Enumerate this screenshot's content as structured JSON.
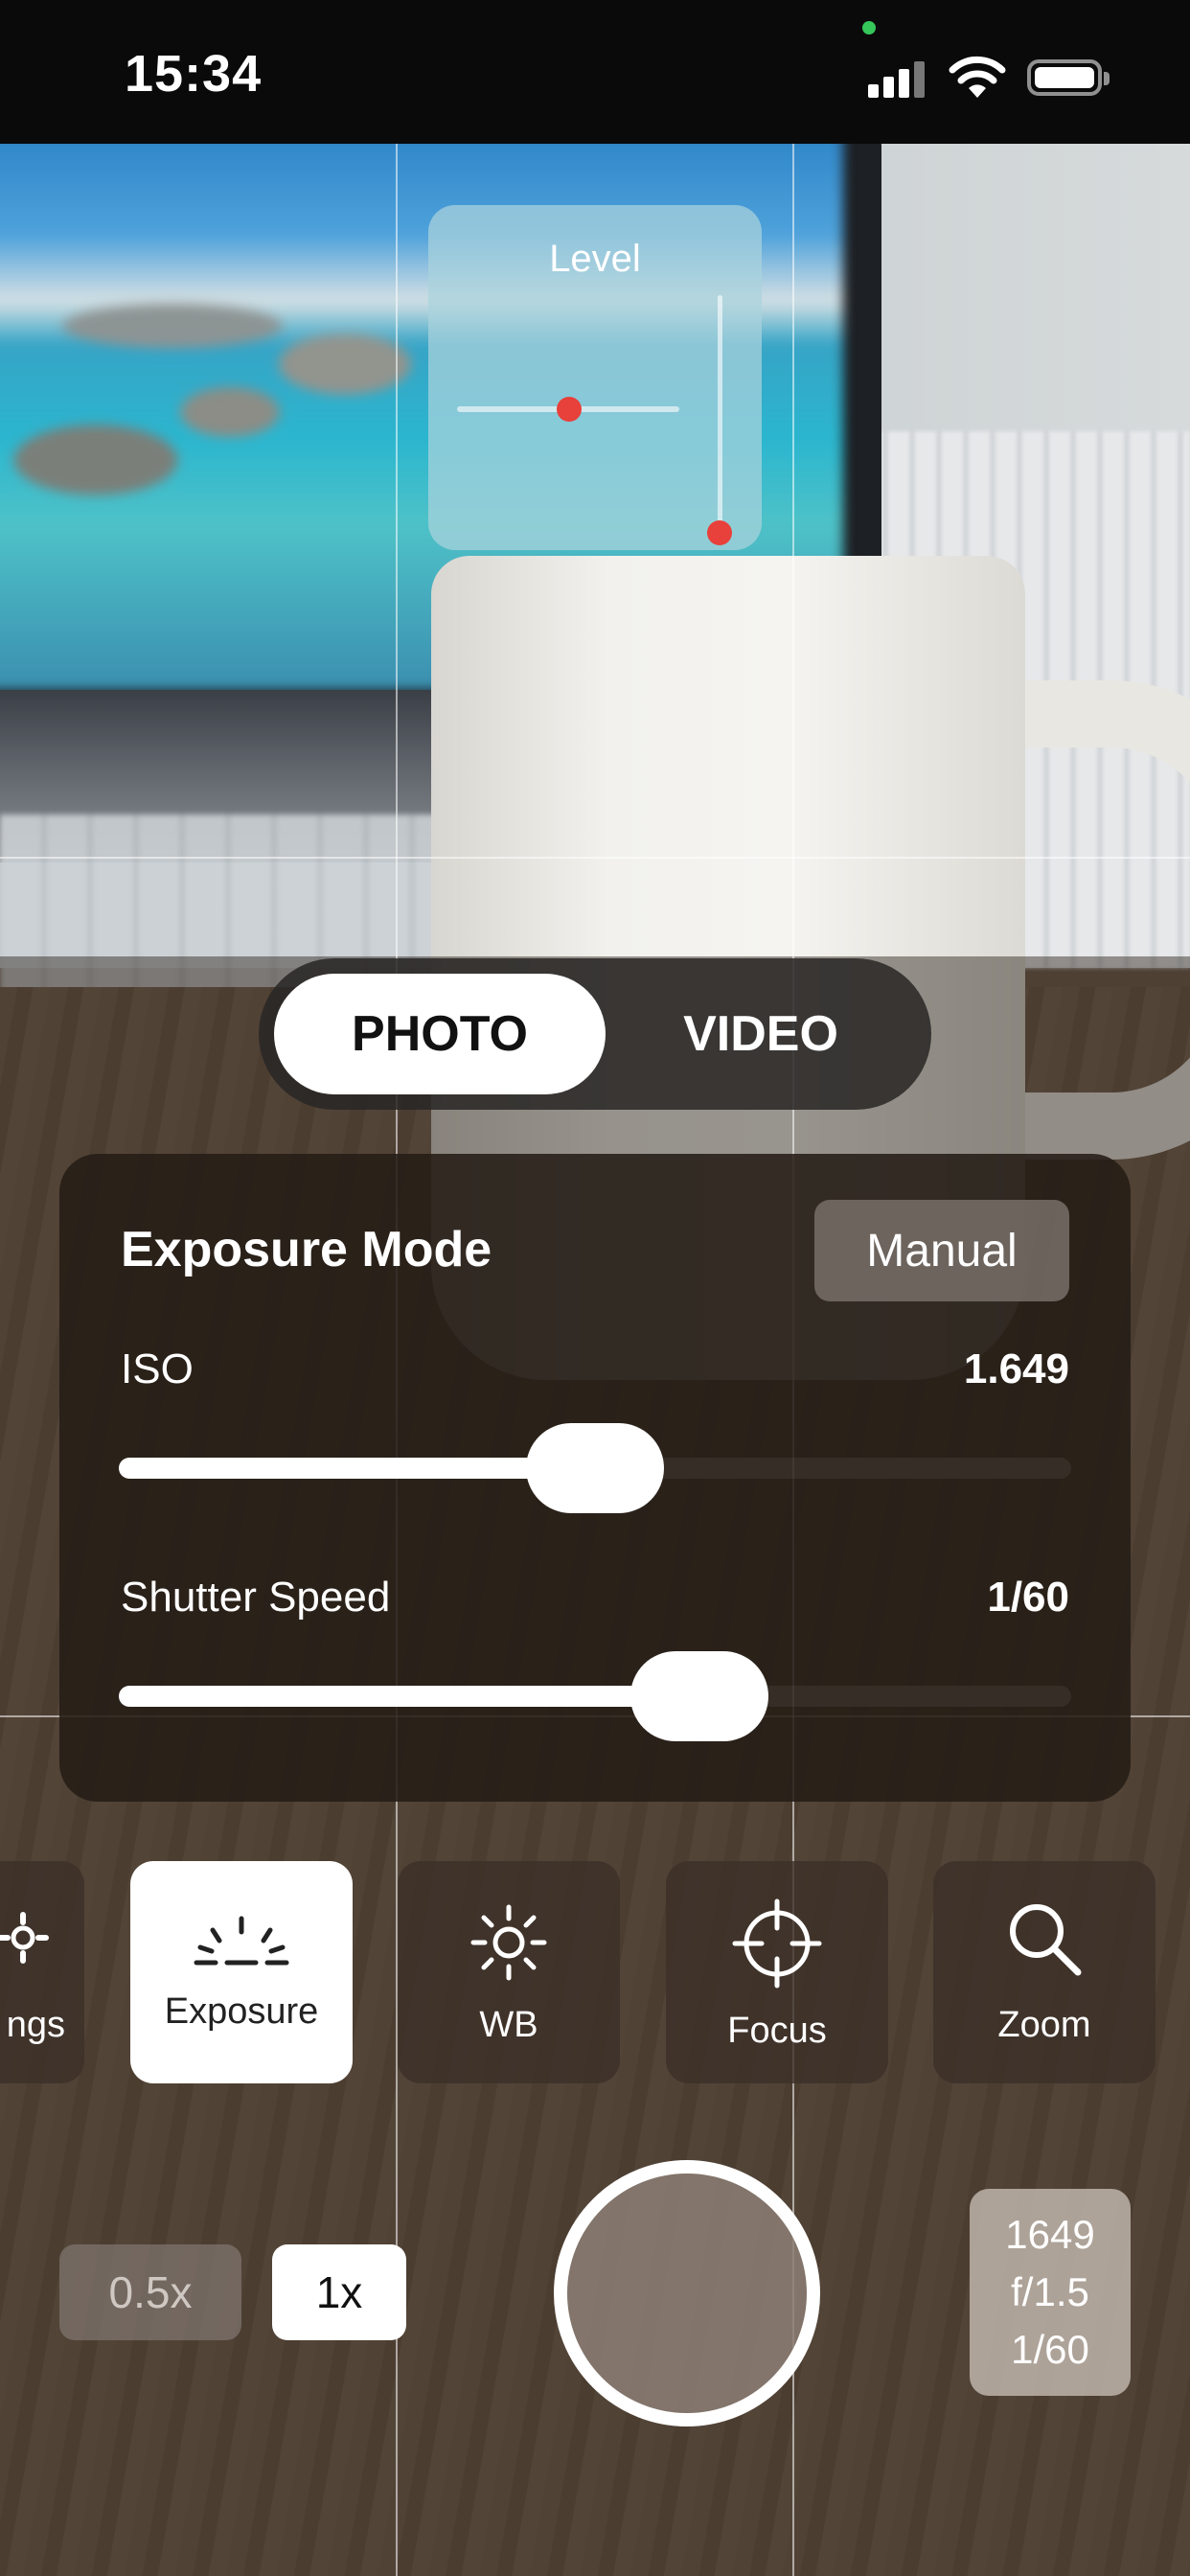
{
  "status_bar": {
    "time": "15:34",
    "icons": [
      "green-indicator-dot",
      "cellular-signal-icon",
      "wifi-icon",
      "battery-icon"
    ]
  },
  "level": {
    "title": "Level"
  },
  "mode_toggle": {
    "photo_label": "PHOTO",
    "video_label": "VIDEO",
    "selected": "PHOTO"
  },
  "exposure_panel": {
    "title": "Exposure Mode",
    "mode_button": "Manual",
    "iso": {
      "label": "ISO",
      "value": "1.649",
      "slider_fraction": 0.5
    },
    "shutter_speed": {
      "label": "Shutter Speed",
      "value": "1/60",
      "slider_fraction": 0.61
    }
  },
  "tools": [
    {
      "label": "ngs",
      "icon": "settings-icon",
      "active": false
    },
    {
      "label": "Exposure",
      "icon": "exposure-icon",
      "active": true
    },
    {
      "label": "WB",
      "icon": "sun-icon",
      "active": false
    },
    {
      "label": "Focus",
      "icon": "crosshair-icon",
      "active": false
    },
    {
      "label": "Zoom",
      "icon": "magnifier-icon",
      "active": false
    }
  ],
  "zoom": {
    "options": [
      "0.5x",
      "1x"
    ],
    "selected": "1x"
  },
  "info": {
    "iso": "1649",
    "aperture": "f/1.5",
    "shutter": "1/60"
  },
  "colors": {
    "accent_red": "#e8403a",
    "status_green": "#35c759"
  }
}
